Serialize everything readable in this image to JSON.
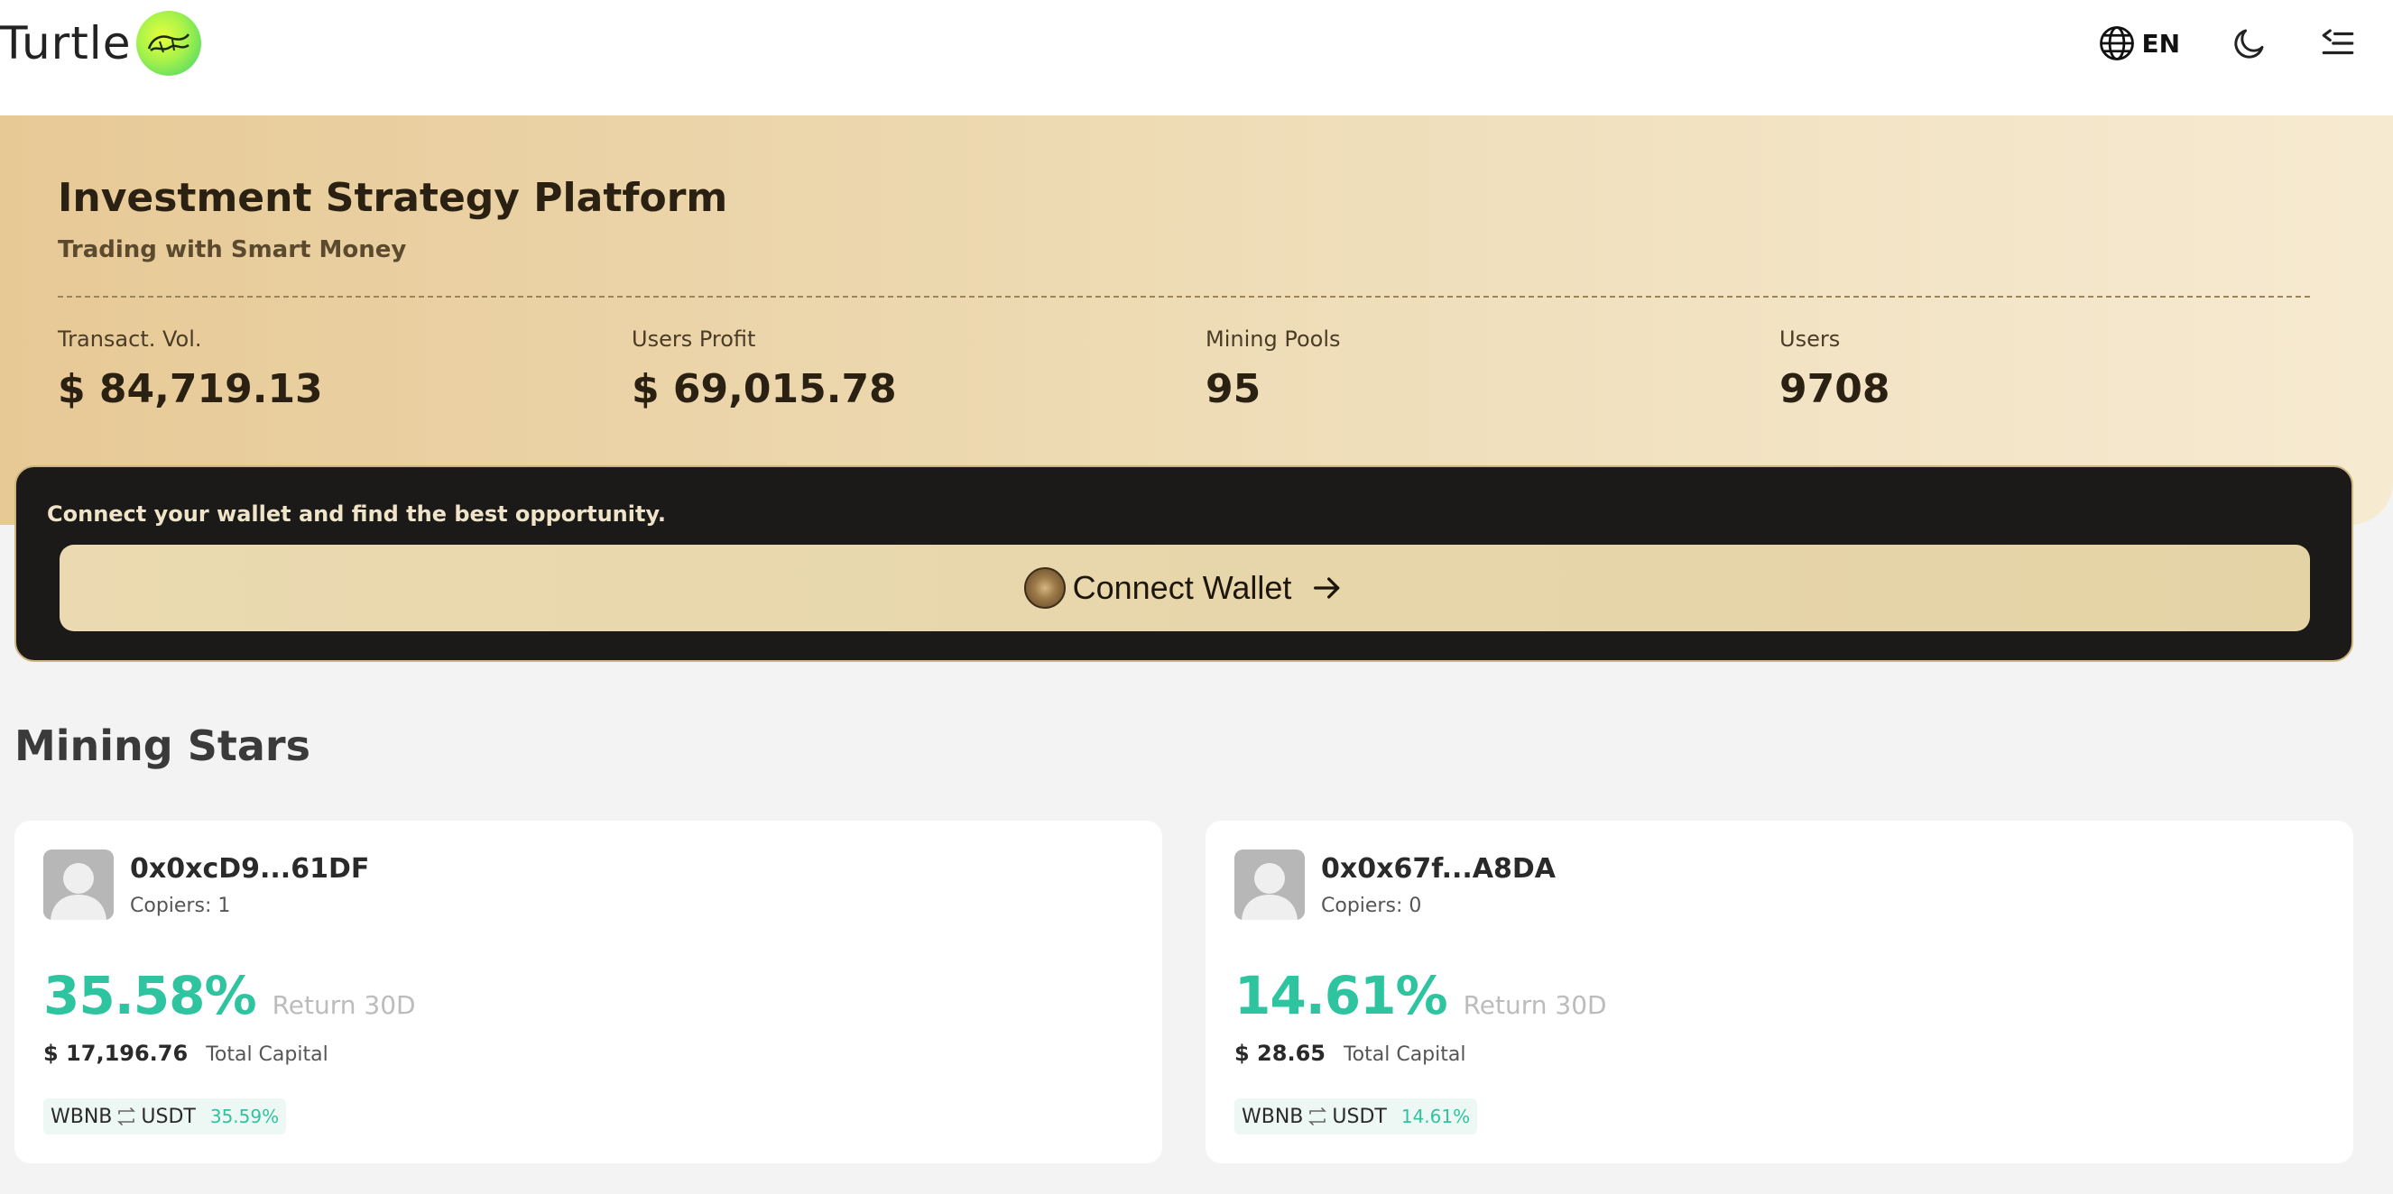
{
  "header": {
    "logo_text": "Turtle",
    "language": "EN"
  },
  "hero": {
    "title": "Investment Strategy Platform",
    "subtitle": "Trading with Smart Money",
    "stats": [
      {
        "label": "Transact. Vol.",
        "value": "$ 84,719.13"
      },
      {
        "label": "Users Profit",
        "value": "$ 69,015.78"
      },
      {
        "label": "Mining Pools",
        "value": "95"
      },
      {
        "label": "Users",
        "value": "9708"
      }
    ]
  },
  "wallet": {
    "message": "Connect your wallet and find the best opportunity.",
    "button_label": "Connect Wallet"
  },
  "mining_stars": {
    "title": "Mining Stars",
    "cards": [
      {
        "address": "0x0xcD9...61DF",
        "copiers": "Copiers: 1",
        "return_value": "35.58%",
        "return_label": "Return 30D",
        "capital_value": "$ 17,196.76",
        "capital_label": "Total Capital",
        "pair_from": "WBNB",
        "pair_to": "USDT",
        "pair_pct": "35.59%"
      },
      {
        "address": "0x0x67f...A8DA",
        "copiers": "Copiers: 0",
        "return_value": "14.61%",
        "return_label": "Return 30D",
        "capital_value": "$ 28.65",
        "capital_label": "Total Capital",
        "pair_from": "WBNB",
        "pair_to": "USDT",
        "pair_pct": "14.61%"
      }
    ]
  },
  "colors": {
    "accent_green": "#2ec4a0",
    "hero_gold": "#e7c996",
    "panel_dark": "#1b1a19"
  }
}
